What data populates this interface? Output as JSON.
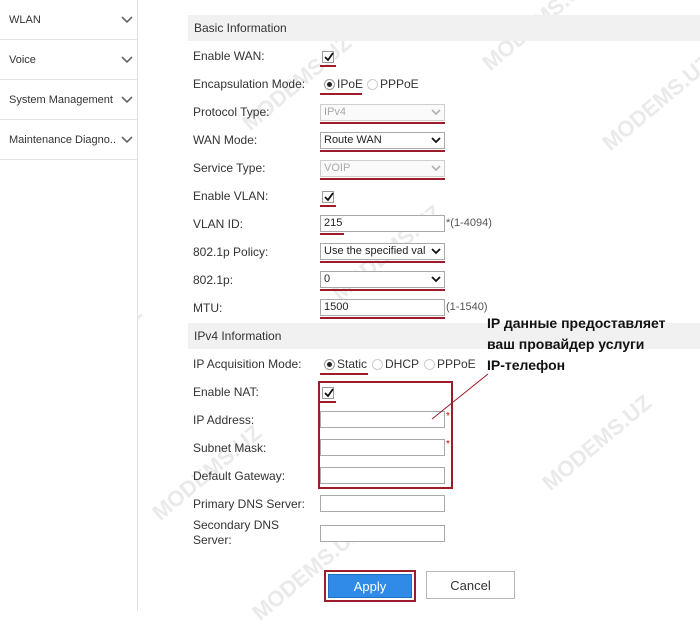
{
  "sidebar": {
    "items": [
      {
        "label": "WLAN"
      },
      {
        "label": "Voice"
      },
      {
        "label": "System Management"
      },
      {
        "label": "Maintenance Diagno.."
      }
    ]
  },
  "basic": {
    "header": "Basic Information",
    "enable_wan": {
      "label": "Enable WAN:",
      "checked": true
    },
    "encapsulation": {
      "label": "Encapsulation Mode:",
      "options": [
        "IPoE",
        "PPPoE"
      ],
      "selected": "IPoE"
    },
    "protocol_type": {
      "label": "Protocol Type:",
      "value": "IPv4"
    },
    "wan_mode": {
      "label": "WAN Mode:",
      "value": "Route WAN"
    },
    "service_type": {
      "label": "Service Type:",
      "value": "VOIP"
    },
    "enable_vlan": {
      "label": "Enable VLAN:",
      "checked": true
    },
    "vlan_id": {
      "label": "VLAN ID:",
      "value": "215",
      "hint": "*(1-4094)"
    },
    "policy": {
      "label": "802.1p Policy:",
      "value": "Use the specified val"
    },
    "p8021": {
      "label": "802.1p:",
      "value": "0"
    },
    "mtu": {
      "label": "MTU:",
      "value": "1500",
      "hint": "(1-1540)"
    }
  },
  "ipv4": {
    "header": "IPv4 Information",
    "acquisition": {
      "label": "IP Acquisition Mode:",
      "options": [
        "Static",
        "DHCP",
        "PPPoE"
      ],
      "selected": "Static"
    },
    "enable_nat": {
      "label": "Enable NAT:",
      "checked": true
    },
    "ip_address": {
      "label": "IP Address:",
      "value": "",
      "required": "*"
    },
    "subnet_mask": {
      "label": "Subnet Mask:",
      "value": "",
      "required": "*"
    },
    "default_gateway": {
      "label": "Default Gateway:",
      "value": ""
    },
    "primary_dns": {
      "label": "Primary DNS Server:",
      "value": ""
    },
    "secondary_dns": {
      "label": "Secondary DNS Server:",
      "value": ""
    }
  },
  "annotation": {
    "lines": [
      "IP данные предоставляет",
      "ваш провайдер услуги",
      "IP-телефон"
    ]
  },
  "buttons": {
    "apply": "Apply",
    "cancel": "Cancel"
  },
  "watermark": "MODEMS.UZ",
  "colors": {
    "highlight": "#9b1c2a",
    "apply_bg": "#2f8ae8",
    "section_bg": "#f1f1f1"
  }
}
